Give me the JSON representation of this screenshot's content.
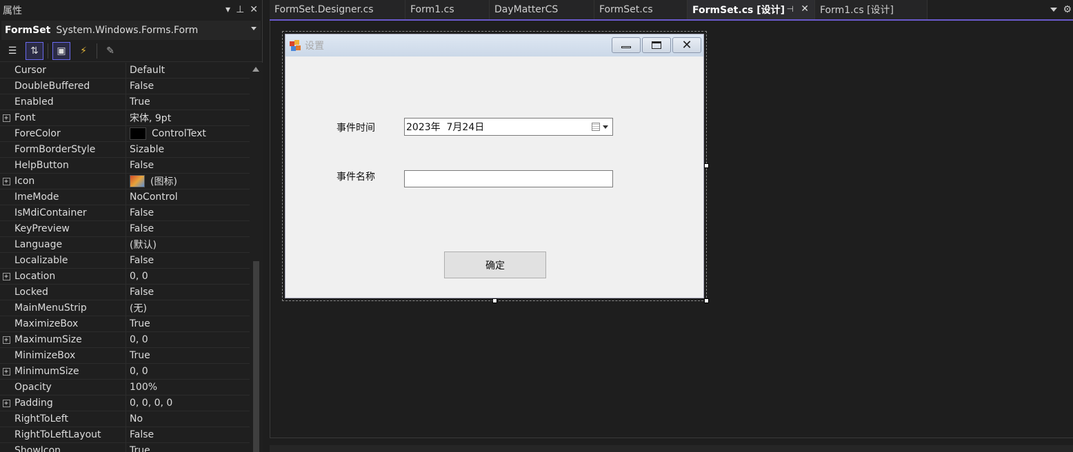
{
  "properties_panel": {
    "title": "属性",
    "object_name": "FormSet",
    "object_type": "System.Windows.Forms.Form",
    "rows": [
      {
        "name": "Cursor",
        "value": "Default",
        "expandable": false
      },
      {
        "name": "DoubleBuffered",
        "value": "False",
        "expandable": false
      },
      {
        "name": "Enabled",
        "value": "True",
        "expandable": false
      },
      {
        "name": "Font",
        "value": "宋体, 9pt",
        "expandable": true
      },
      {
        "name": "ForeColor",
        "value": "ControlText",
        "expandable": false,
        "swatch": "#000000"
      },
      {
        "name": "FormBorderStyle",
        "value": "Sizable",
        "expandable": false
      },
      {
        "name": "HelpButton",
        "value": "False",
        "expandable": false
      },
      {
        "name": "Icon",
        "value": "(图标)",
        "expandable": true,
        "icon_swatch": true
      },
      {
        "name": "ImeMode",
        "value": "NoControl",
        "expandable": false
      },
      {
        "name": "IsMdiContainer",
        "value": "False",
        "expandable": false
      },
      {
        "name": "KeyPreview",
        "value": "False",
        "expandable": false
      },
      {
        "name": "Language",
        "value": "(默认)",
        "expandable": false
      },
      {
        "name": "Localizable",
        "value": "False",
        "expandable": false
      },
      {
        "name": "Location",
        "value": "0, 0",
        "expandable": true
      },
      {
        "name": "Locked",
        "value": "False",
        "expandable": false
      },
      {
        "name": "MainMenuStrip",
        "value": "(无)",
        "expandable": false
      },
      {
        "name": "MaximizeBox",
        "value": "True",
        "expandable": false
      },
      {
        "name": "MaximumSize",
        "value": "0, 0",
        "expandable": true
      },
      {
        "name": "MinimizeBox",
        "value": "True",
        "expandable": false
      },
      {
        "name": "MinimumSize",
        "value": "0, 0",
        "expandable": true
      },
      {
        "name": "Opacity",
        "value": "100%",
        "expandable": false
      },
      {
        "name": "Padding",
        "value": "0, 0, 0, 0",
        "expandable": true
      },
      {
        "name": "RightToLeft",
        "value": "No",
        "expandable": false
      },
      {
        "name": "RightToLeftLayout",
        "value": "False",
        "expandable": false
      },
      {
        "name": "ShowIcon",
        "value": "True",
        "expandable": false
      }
    ]
  },
  "tabs": [
    {
      "label": "FormSet.Designer.cs",
      "active": false
    },
    {
      "label": "Form1.cs",
      "active": false
    },
    {
      "label": "DayMatterCS",
      "active": false
    },
    {
      "label": "FormSet.cs",
      "active": false
    },
    {
      "label": "FormSet.cs [设计]",
      "active": true
    },
    {
      "label": "Form1.cs [设计]",
      "active": false
    }
  ],
  "form": {
    "title": "设置",
    "label_time": "事件时间",
    "date_value": "2023年  7月24日",
    "label_name": "事件名称",
    "name_value": "",
    "ok_button": "确定"
  }
}
